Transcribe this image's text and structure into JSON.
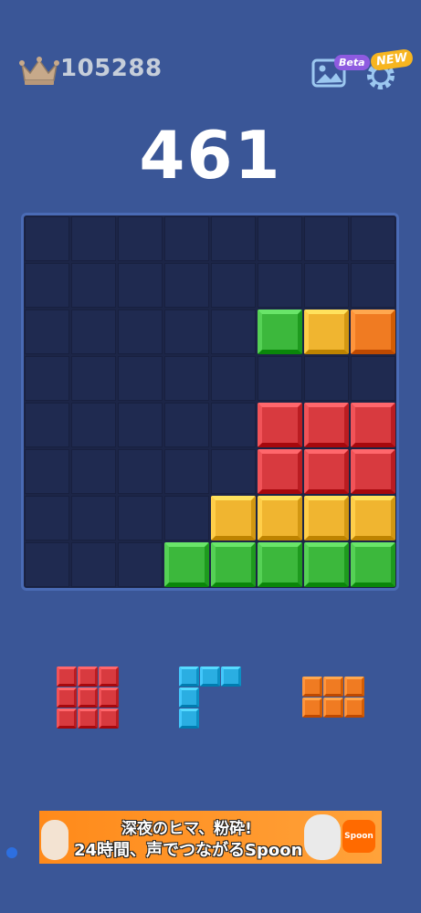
{
  "header": {
    "best_score": "105288",
    "score": "461",
    "theme_badge": "Beta",
    "settings_badge": "NEW",
    "icons": [
      "crown-icon",
      "image-icon",
      "gear-icon"
    ]
  },
  "colors": {
    "red": "#d83a3f",
    "green": "#3cb83c",
    "yellow": "#f0b530",
    "orange": "#f07b22",
    "blue": "#2aaee2",
    "board_bg": "#1c2547",
    "page_bg": "#3a5697"
  },
  "board": {
    "size": 8,
    "filled": [
      {
        "r": 2,
        "c": 5,
        "color": "green"
      },
      {
        "r": 2,
        "c": 6,
        "color": "yellow"
      },
      {
        "r": 2,
        "c": 7,
        "color": "orange"
      },
      {
        "r": 4,
        "c": 5,
        "color": "red"
      },
      {
        "r": 4,
        "c": 6,
        "color": "red"
      },
      {
        "r": 4,
        "c": 7,
        "color": "red"
      },
      {
        "r": 5,
        "c": 5,
        "color": "red"
      },
      {
        "r": 5,
        "c": 6,
        "color": "red"
      },
      {
        "r": 5,
        "c": 7,
        "color": "red"
      },
      {
        "r": 6,
        "c": 4,
        "color": "yellow"
      },
      {
        "r": 6,
        "c": 5,
        "color": "yellow"
      },
      {
        "r": 6,
        "c": 6,
        "color": "yellow"
      },
      {
        "r": 6,
        "c": 7,
        "color": "yellow"
      },
      {
        "r": 7,
        "c": 3,
        "color": "green"
      },
      {
        "r": 7,
        "c": 4,
        "color": "green"
      },
      {
        "r": 7,
        "c": 5,
        "color": "green"
      },
      {
        "r": 7,
        "c": 6,
        "color": "green"
      },
      {
        "r": 7,
        "c": 7,
        "color": "green"
      }
    ]
  },
  "pieces": [
    {
      "name": "red-square-piece",
      "color": "red",
      "cells": [
        [
          0,
          0
        ],
        [
          0,
          1
        ],
        [
          0,
          2
        ],
        [
          1,
          0
        ],
        [
          1,
          1
        ],
        [
          1,
          2
        ],
        [
          2,
          0
        ],
        [
          2,
          1
        ],
        [
          2,
          2
        ]
      ]
    },
    {
      "name": "blue-corner-piece",
      "color": "blue",
      "cells": [
        [
          0,
          0
        ],
        [
          0,
          1
        ],
        [
          0,
          2
        ],
        [
          1,
          0
        ],
        [
          2,
          0
        ]
      ]
    },
    {
      "name": "orange-rect-piece",
      "color": "orange",
      "cells": [
        [
          0,
          0
        ],
        [
          0,
          1
        ],
        [
          0,
          2
        ],
        [
          1,
          0
        ],
        [
          1,
          1
        ],
        [
          1,
          2
        ]
      ]
    }
  ],
  "ad": {
    "line1": "深夜のヒマ、粉砕!",
    "line2": "24時間、声でつながるSpoon",
    "logo": "Spoon"
  }
}
